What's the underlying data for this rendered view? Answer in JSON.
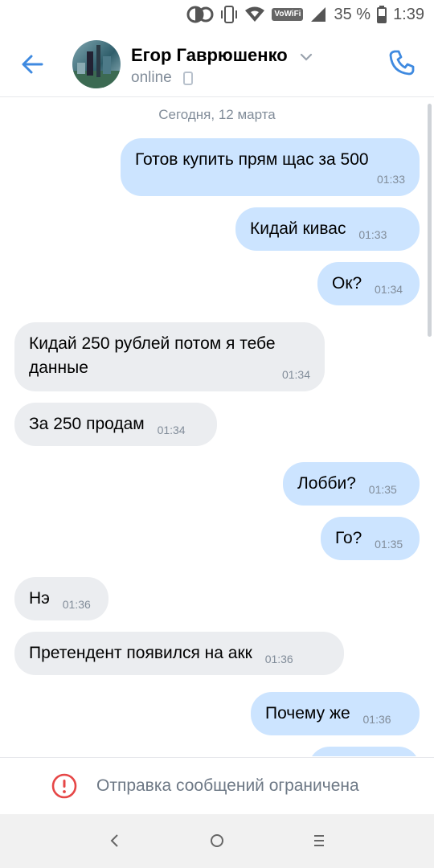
{
  "status_bar": {
    "vowifi": "VoWiFi",
    "battery": "35 %",
    "time": "1:39"
  },
  "header": {
    "contact_name": "Егор Гаврюшенко",
    "status": "online"
  },
  "chat": {
    "date_separator": "Сегодня, 12 марта",
    "messages": [
      {
        "dir": "out",
        "text": "Готов купить прям щас за 500",
        "time": "01:33"
      },
      {
        "dir": "out",
        "text": "Кидай кивас",
        "time": "01:33"
      },
      {
        "dir": "out",
        "text": "Ок?",
        "time": "01:34"
      },
      {
        "dir": "in",
        "text": "Кидай 250 рублей потом я тебе данные",
        "time": "01:34"
      },
      {
        "dir": "in",
        "text": "За 250 продам",
        "time": "01:34"
      },
      {
        "dir": "out",
        "text": "Лобби?",
        "time": "01:35"
      },
      {
        "dir": "out",
        "text": "Го?",
        "time": "01:35"
      },
      {
        "dir": "in",
        "text": "Нэ",
        "time": "01:36"
      },
      {
        "dir": "in",
        "text": "Претендент появился на акк",
        "time": "01:36"
      },
      {
        "dir": "out",
        "text": "Почему же",
        "time": "01:36"
      }
    ]
  },
  "footer": {
    "notice": "Отправка сообщений ограничена"
  },
  "colors": {
    "accent": "#3f8ae0",
    "outgoing_bubble": "#cce4ff",
    "incoming_bubble": "#ebedf0",
    "warning": "#e64646"
  }
}
